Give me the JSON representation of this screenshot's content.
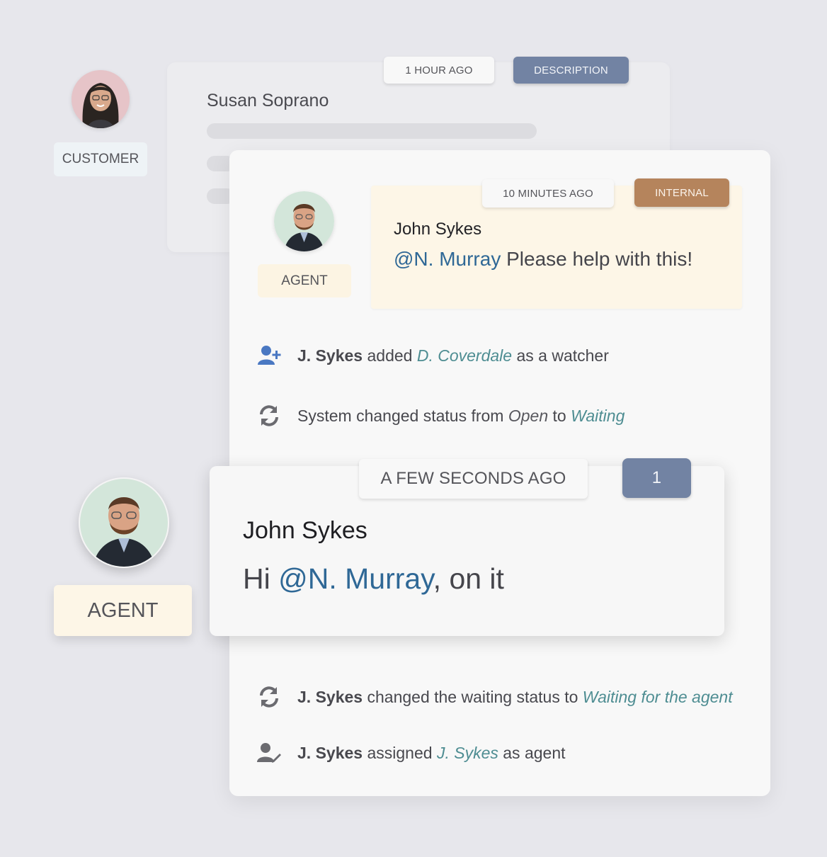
{
  "customer": {
    "badge": "CUSTOMER",
    "card": {
      "time": "1 HOUR AGO",
      "tag": "DESCRIPTION",
      "name": "Susan Soprano"
    }
  },
  "internal_note": {
    "time": "10 MINUTES AGO",
    "tag": "INTERNAL",
    "author": "John Sykes",
    "mention": "@N. Murray",
    "text": " Please help with this!",
    "role": "AGENT"
  },
  "activities": [
    {
      "icon": "add-user-icon",
      "actor": "J. Sykes",
      "pre": " added ",
      "target": "D. Coverdale",
      "post": " as a watcher"
    },
    {
      "icon": "refresh-icon",
      "actor": "",
      "pre": "System changed status from ",
      "from": "Open",
      "mid": " to ",
      "target": "Waiting"
    }
  ],
  "reply": {
    "time": "A FEW SECONDS AGO",
    "count": "1",
    "author": "John Sykes",
    "greeting": "Hi ",
    "mention": "@N. Murray",
    "text": ", on it",
    "role": "AGENT"
  },
  "activities_after": [
    {
      "icon": "refresh-icon",
      "actor": "J. Sykes",
      "pre": " changed the waiting status to ",
      "target": "Waiting for the agent"
    },
    {
      "icon": "assign-user-icon",
      "actor": "J. Sykes",
      "pre": " assigned ",
      "target": "J. Sykes",
      "post": " as agent"
    }
  ],
  "colors": {
    "background": "#e7e7ec",
    "mention": "#2f6896",
    "teal": "#4e8d92",
    "description_tag": "#7283a3",
    "internal_tag": "#b5845c",
    "note_bg": "#fdf6e7",
    "icon_blue": "#4a78c2"
  }
}
